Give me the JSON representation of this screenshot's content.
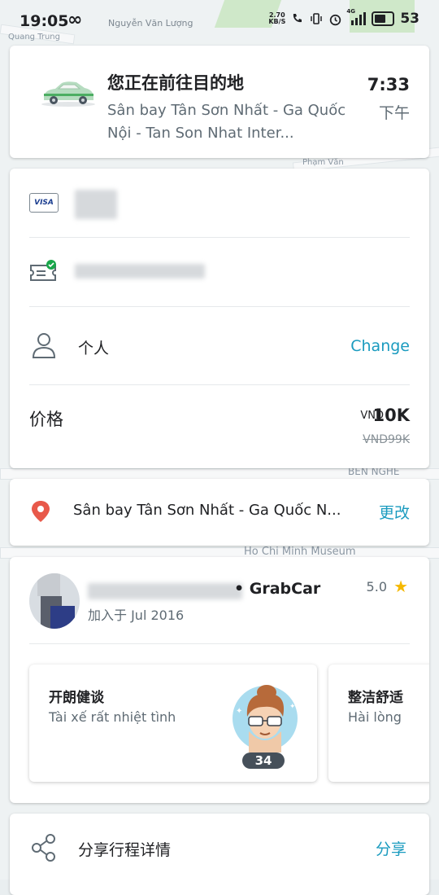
{
  "status_bar": {
    "time": "19:05",
    "infinity": "∞",
    "carrier_name": "Nguyễn Văn Lượng",
    "speed_value": "2.70",
    "speed_unit": "KB/S",
    "network": "4G",
    "battery": "53"
  },
  "map": {
    "labels": [
      "Quang Trung",
      "Phạm Văn",
      "BẾN NGHÉ",
      "Ho Chi Minh Museum"
    ]
  },
  "trip": {
    "title": "您正在前往目的地",
    "destination": "Sân bay Tân Sơn Nhất - Ga Quốc Nội - Tan Son Nhat Inter...",
    "eta_time": "7:33",
    "eta_ampm": "下午"
  },
  "payment": {
    "visa_label": "VISA",
    "profile_label": "个人",
    "change_label": "Change",
    "price_label": "价格",
    "currency": "VND",
    "price": "10K",
    "original_price": "VND99K"
  },
  "destination_card": {
    "address": "Sân bay Tân Sơn Nhất - Ga Quốc N...",
    "change_label": "更改"
  },
  "driver": {
    "name": "• GrabCar",
    "joined": "加入于 Jul 2016",
    "rating": "5.0",
    "compliments": [
      {
        "title": "开朗健谈",
        "subtitle": "Tài xế rất nhiệt tình",
        "count": "34"
      },
      {
        "title": "整洁舒适",
        "subtitle": "Hài lòng"
      }
    ]
  },
  "share": {
    "label": "分享行程详情",
    "action": "分享"
  },
  "colors": {
    "accent": "#1a9bbf",
    "pin": "#e8594a",
    "star": "#f5b800",
    "check": "#19a64a"
  }
}
